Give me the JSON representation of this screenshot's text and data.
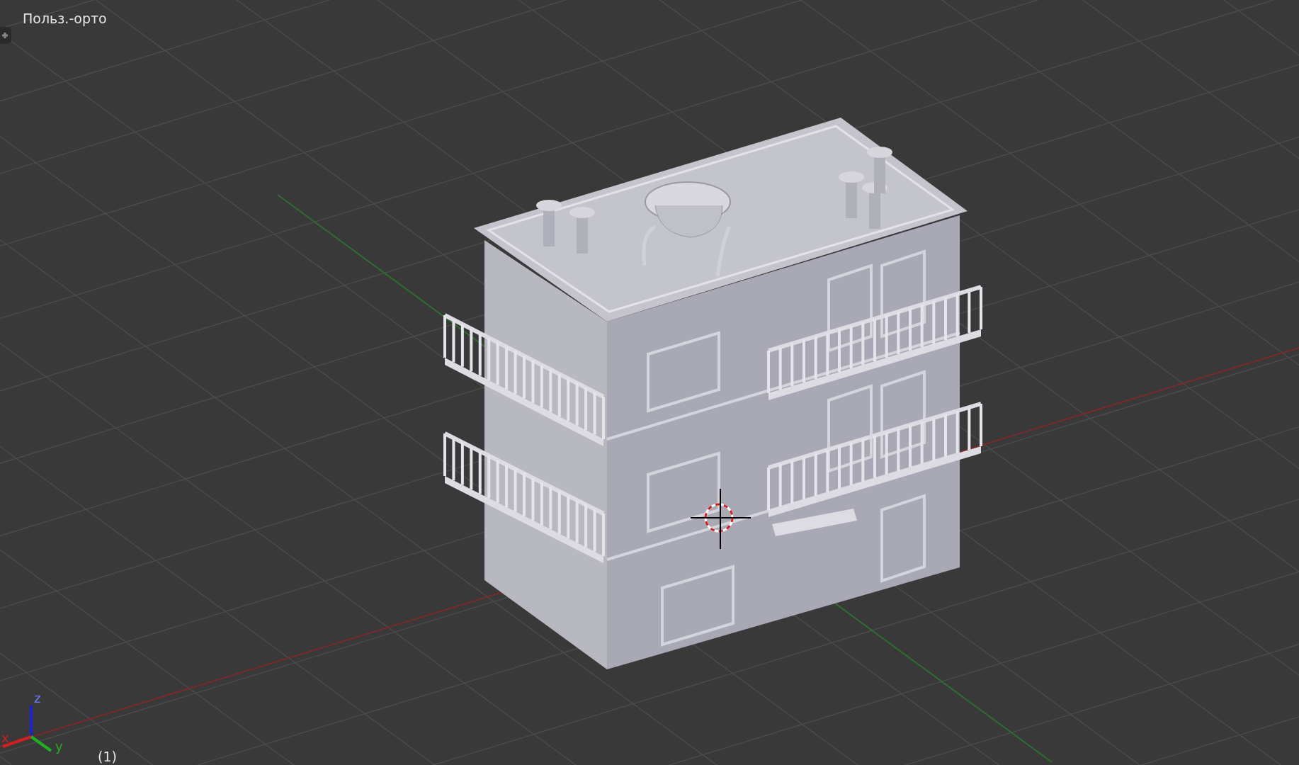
{
  "viewport": {
    "view_label": "Польз.-орто",
    "frame_label": "(1)"
  },
  "axis_gizmo": {
    "x_label": "x",
    "y_label": "y",
    "z_label": "z"
  }
}
